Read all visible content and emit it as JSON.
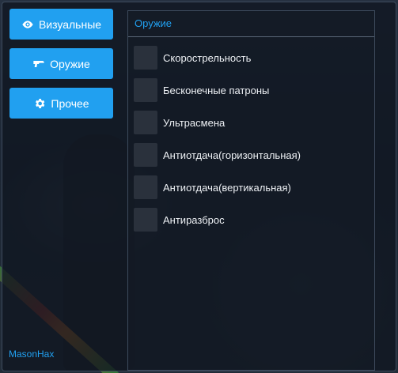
{
  "nav": {
    "items": [
      {
        "label": "Визуальные",
        "icon": "eye-icon"
      },
      {
        "label": "Оружие",
        "icon": "gun-icon"
      },
      {
        "label": "Прочее",
        "icon": "gear-icon"
      }
    ]
  },
  "brand": "MasonHax",
  "panel": {
    "title": "Оружие",
    "options": [
      {
        "label": "Скорострельность",
        "checked": false
      },
      {
        "label": "Бесконечные патроны",
        "checked": false
      },
      {
        "label": "Ультрасмена",
        "checked": false
      },
      {
        "label": "Антиотдача(горизонтальная)",
        "checked": false
      },
      {
        "label": "Антиотдача(вертикальная)",
        "checked": false
      },
      {
        "label": "Антиразброс",
        "checked": false
      }
    ]
  },
  "colors": {
    "accent": "#21a0f0",
    "checkbox": "#2a313c",
    "text": "#eef1f5"
  }
}
